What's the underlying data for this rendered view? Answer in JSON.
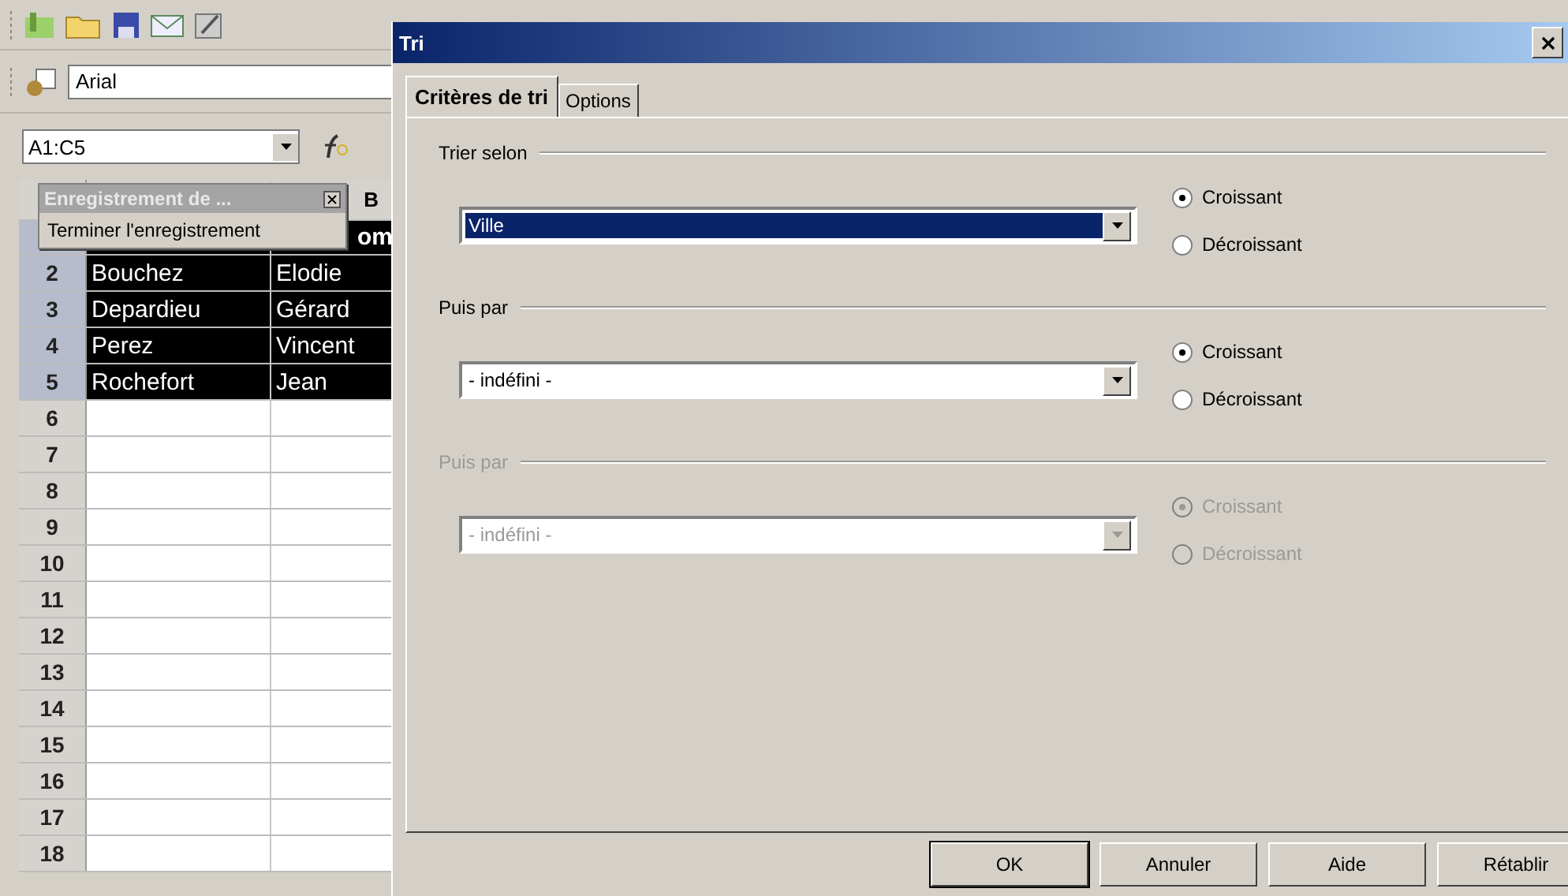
{
  "app": {
    "font_name": "Arial",
    "name_box": "A1:C5"
  },
  "recording_toolbar": {
    "title": "Enregistrement de ...",
    "button": "Terminer l'enregistrement"
  },
  "sheet": {
    "column_b_header": "B",
    "partial_cell": "om",
    "rows": [
      {
        "number": "2",
        "selected": true,
        "cells": [
          "Bouchez",
          "Elodie"
        ]
      },
      {
        "number": "3",
        "selected": true,
        "cells": [
          "Depardieu",
          "Gérard"
        ]
      },
      {
        "number": "4",
        "selected": true,
        "cells": [
          "Perez",
          "Vincent"
        ]
      },
      {
        "number": "5",
        "selected": true,
        "cells": [
          "Rochefort",
          "Jean"
        ]
      },
      {
        "number": "6",
        "selected": false
      },
      {
        "number": "7",
        "selected": false
      },
      {
        "number": "8",
        "selected": false
      },
      {
        "number": "9",
        "selected": false
      },
      {
        "number": "10",
        "selected": false
      },
      {
        "number": "11",
        "selected": false
      },
      {
        "number": "12",
        "selected": false
      },
      {
        "number": "13",
        "selected": false
      },
      {
        "number": "14",
        "selected": false
      },
      {
        "number": "15",
        "selected": false
      },
      {
        "number": "16",
        "selected": false
      },
      {
        "number": "17",
        "selected": false
      },
      {
        "number": "18",
        "selected": false
      }
    ]
  },
  "dialog": {
    "title": "Tri",
    "tabs": [
      {
        "label": "Critères de tri",
        "selected": true
      },
      {
        "label": "Options",
        "selected": false
      }
    ],
    "sections": [
      {
        "label": "Trier selon",
        "disabled": false,
        "value": "Ville",
        "highlighted": true,
        "options": [
          {
            "label": "Croissant",
            "selected": true
          },
          {
            "label": "Décroissant",
            "selected": false
          }
        ]
      },
      {
        "label": "Puis par",
        "disabled": false,
        "value": "- indéfini -",
        "highlighted": false,
        "options": [
          {
            "label": "Croissant",
            "selected": true
          },
          {
            "label": "Décroissant",
            "selected": false
          }
        ]
      },
      {
        "label": "Puis par",
        "disabled": true,
        "value": "- indéfini -",
        "highlighted": false,
        "options": [
          {
            "label": "Croissant",
            "selected": true
          },
          {
            "label": "Décroissant",
            "selected": false
          }
        ]
      }
    ],
    "buttons": [
      {
        "label": "OK",
        "default": true
      },
      {
        "label": "Annuler",
        "default": false
      },
      {
        "label": "Aide",
        "default": false
      },
      {
        "label": "Rétablir",
        "default": false
      }
    ]
  }
}
